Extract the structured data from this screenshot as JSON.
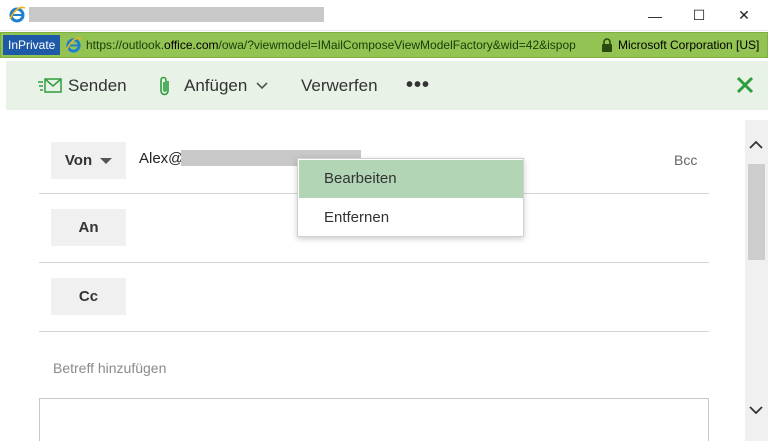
{
  "window": {
    "minimize_glyph": "—",
    "maximize_glyph": "☐",
    "close_glyph": "✕"
  },
  "addressbar": {
    "inprivate_label": "InPrivate",
    "url_prefix": "https://outlook.",
    "url_domain": "office.com",
    "url_path": "/owa/?viewmodel=IMailComposeViewModelFactory&wid=42&ispop",
    "company": "Microsoft Corporation [US]",
    "bar_color": "#92c353"
  },
  "toolbar": {
    "send_label": "Senden",
    "attach_label": "Anfügen",
    "discard_label": "Verwerfen",
    "more_label": "•••",
    "accent_color": "#2e9e3f"
  },
  "compose": {
    "from_label": "Von",
    "from_value": "Alex@",
    "to_label": "An",
    "cc_label": "Cc",
    "bcc_label": "Bcc",
    "subject_placeholder": "Betreff hinzufügen"
  },
  "context_menu": {
    "items": [
      {
        "label": "Bearbeiten"
      },
      {
        "label": "Entfernen"
      }
    ],
    "highlight_color": "#b2d6b5"
  },
  "icons": {
    "ie": "ie-logo-icon",
    "lock": "lock-icon",
    "send": "send-icon",
    "attach": "paperclip-icon",
    "close": "close-icon"
  }
}
